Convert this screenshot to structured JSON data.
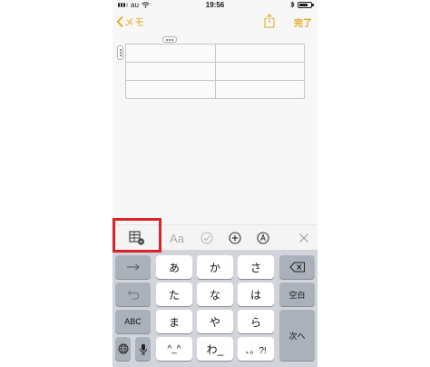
{
  "status_bar": {
    "carrier": "au",
    "time": "19:56"
  },
  "nav": {
    "back_label": "メモ",
    "done_label": "完了"
  },
  "note_table": {
    "rows": [
      [
        "",
        ""
      ],
      [
        "",
        ""
      ],
      [
        "",
        ""
      ]
    ]
  },
  "toolbar": {
    "text_style_label": "Aa"
  },
  "keyboard": {
    "row1": {
      "k1": "あ",
      "k2": "か",
      "k3": "さ"
    },
    "row2": {
      "k1": "た",
      "k2": "な",
      "k3": "は",
      "space": "空白"
    },
    "row3": {
      "abc": "ABC",
      "k1": "ま",
      "k2": "や",
      "k3": "ら",
      "next": "次へ"
    },
    "row4": {
      "k1": "^_^",
      "k2": "わ_",
      "k3": "、。?!"
    }
  },
  "colors": {
    "accent": "#e2a91d",
    "highlight": "#d9242a",
    "keyboard_bg": "#d1d5db",
    "function_key": "#abb1ba"
  }
}
